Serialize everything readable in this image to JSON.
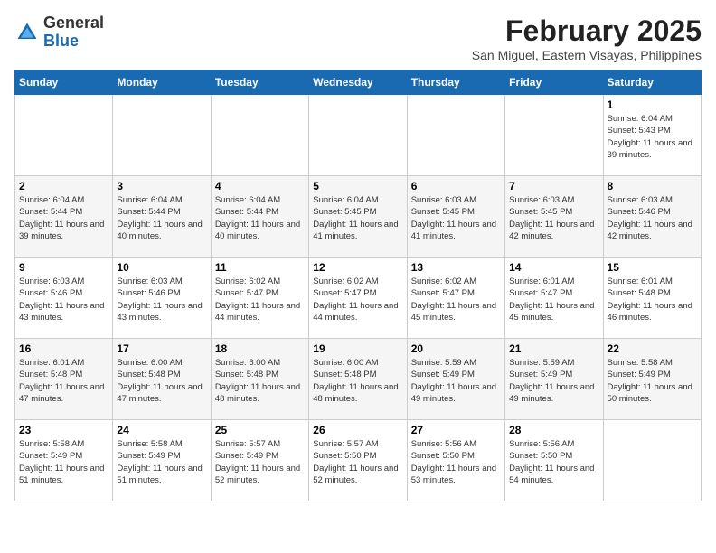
{
  "header": {
    "logo_general": "General",
    "logo_blue": "Blue",
    "month_title": "February 2025",
    "subtitle": "San Miguel, Eastern Visayas, Philippines"
  },
  "days_of_week": [
    "Sunday",
    "Monday",
    "Tuesday",
    "Wednesday",
    "Thursday",
    "Friday",
    "Saturday"
  ],
  "weeks": [
    [
      {
        "day": "",
        "info": ""
      },
      {
        "day": "",
        "info": ""
      },
      {
        "day": "",
        "info": ""
      },
      {
        "day": "",
        "info": ""
      },
      {
        "day": "",
        "info": ""
      },
      {
        "day": "",
        "info": ""
      },
      {
        "day": "1",
        "info": "Sunrise: 6:04 AM\nSunset: 5:43 PM\nDaylight: 11 hours and 39 minutes."
      }
    ],
    [
      {
        "day": "2",
        "info": "Sunrise: 6:04 AM\nSunset: 5:44 PM\nDaylight: 11 hours and 39 minutes."
      },
      {
        "day": "3",
        "info": "Sunrise: 6:04 AM\nSunset: 5:44 PM\nDaylight: 11 hours and 40 minutes."
      },
      {
        "day": "4",
        "info": "Sunrise: 6:04 AM\nSunset: 5:44 PM\nDaylight: 11 hours and 40 minutes."
      },
      {
        "day": "5",
        "info": "Sunrise: 6:04 AM\nSunset: 5:45 PM\nDaylight: 11 hours and 41 minutes."
      },
      {
        "day": "6",
        "info": "Sunrise: 6:03 AM\nSunset: 5:45 PM\nDaylight: 11 hours and 41 minutes."
      },
      {
        "day": "7",
        "info": "Sunrise: 6:03 AM\nSunset: 5:45 PM\nDaylight: 11 hours and 42 minutes."
      },
      {
        "day": "8",
        "info": "Sunrise: 6:03 AM\nSunset: 5:46 PM\nDaylight: 11 hours and 42 minutes."
      }
    ],
    [
      {
        "day": "9",
        "info": "Sunrise: 6:03 AM\nSunset: 5:46 PM\nDaylight: 11 hours and 43 minutes."
      },
      {
        "day": "10",
        "info": "Sunrise: 6:03 AM\nSunset: 5:46 PM\nDaylight: 11 hours and 43 minutes."
      },
      {
        "day": "11",
        "info": "Sunrise: 6:02 AM\nSunset: 5:47 PM\nDaylight: 11 hours and 44 minutes."
      },
      {
        "day": "12",
        "info": "Sunrise: 6:02 AM\nSunset: 5:47 PM\nDaylight: 11 hours and 44 minutes."
      },
      {
        "day": "13",
        "info": "Sunrise: 6:02 AM\nSunset: 5:47 PM\nDaylight: 11 hours and 45 minutes."
      },
      {
        "day": "14",
        "info": "Sunrise: 6:01 AM\nSunset: 5:47 PM\nDaylight: 11 hours and 45 minutes."
      },
      {
        "day": "15",
        "info": "Sunrise: 6:01 AM\nSunset: 5:48 PM\nDaylight: 11 hours and 46 minutes."
      }
    ],
    [
      {
        "day": "16",
        "info": "Sunrise: 6:01 AM\nSunset: 5:48 PM\nDaylight: 11 hours and 47 minutes."
      },
      {
        "day": "17",
        "info": "Sunrise: 6:00 AM\nSunset: 5:48 PM\nDaylight: 11 hours and 47 minutes."
      },
      {
        "day": "18",
        "info": "Sunrise: 6:00 AM\nSunset: 5:48 PM\nDaylight: 11 hours and 48 minutes."
      },
      {
        "day": "19",
        "info": "Sunrise: 6:00 AM\nSunset: 5:48 PM\nDaylight: 11 hours and 48 minutes."
      },
      {
        "day": "20",
        "info": "Sunrise: 5:59 AM\nSunset: 5:49 PM\nDaylight: 11 hours and 49 minutes."
      },
      {
        "day": "21",
        "info": "Sunrise: 5:59 AM\nSunset: 5:49 PM\nDaylight: 11 hours and 49 minutes."
      },
      {
        "day": "22",
        "info": "Sunrise: 5:58 AM\nSunset: 5:49 PM\nDaylight: 11 hours and 50 minutes."
      }
    ],
    [
      {
        "day": "23",
        "info": "Sunrise: 5:58 AM\nSunset: 5:49 PM\nDaylight: 11 hours and 51 minutes."
      },
      {
        "day": "24",
        "info": "Sunrise: 5:58 AM\nSunset: 5:49 PM\nDaylight: 11 hours and 51 minutes."
      },
      {
        "day": "25",
        "info": "Sunrise: 5:57 AM\nSunset: 5:49 PM\nDaylight: 11 hours and 52 minutes."
      },
      {
        "day": "26",
        "info": "Sunrise: 5:57 AM\nSunset: 5:50 PM\nDaylight: 11 hours and 52 minutes."
      },
      {
        "day": "27",
        "info": "Sunrise: 5:56 AM\nSunset: 5:50 PM\nDaylight: 11 hours and 53 minutes."
      },
      {
        "day": "28",
        "info": "Sunrise: 5:56 AM\nSunset: 5:50 PM\nDaylight: 11 hours and 54 minutes."
      },
      {
        "day": "",
        "info": ""
      }
    ]
  ]
}
